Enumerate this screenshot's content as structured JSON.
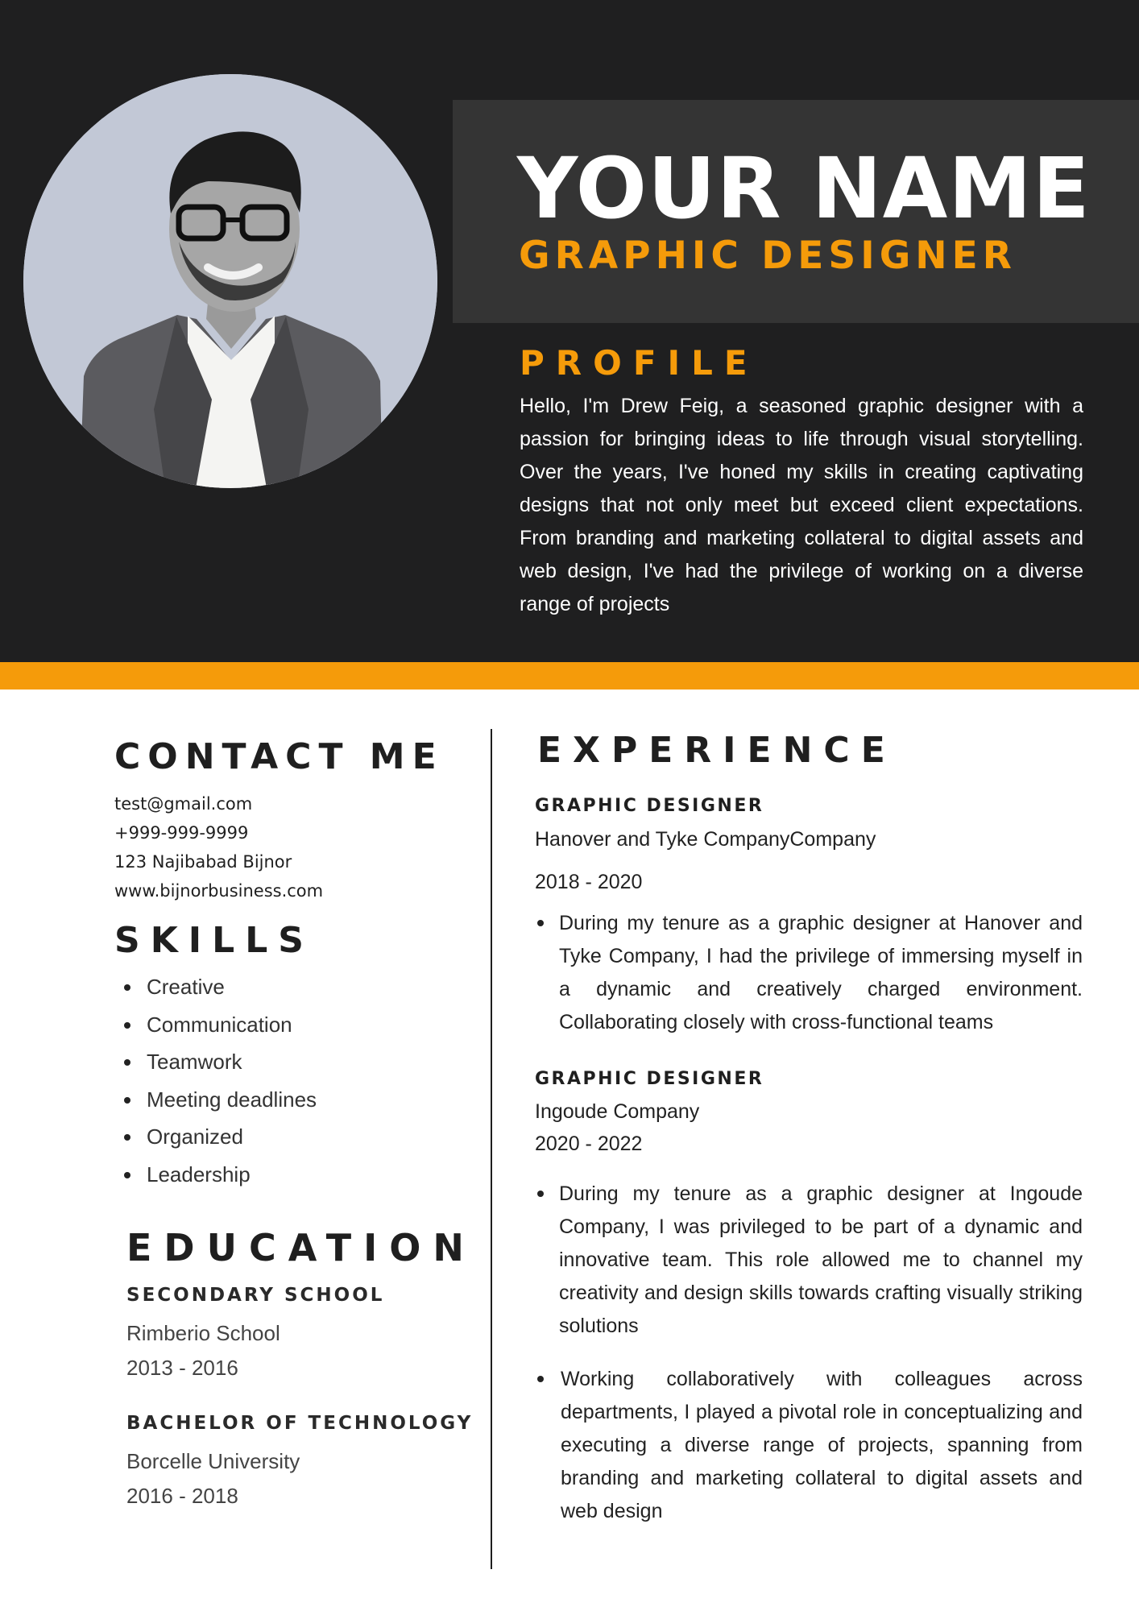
{
  "header": {
    "name": "YOUR NAME",
    "title": "GRAPHIC DESIGNER",
    "photo_icon": "profile-photo",
    "colors": {
      "background": "#1f1f20",
      "panel": "#343434",
      "accent": "#f59b0a"
    }
  },
  "profile": {
    "heading": "PROFILE",
    "text": "Hello, I'm Drew Feig, a seasoned graphic designer with a passion for bringing ideas to life through visual storytelling. Over the years, I've honed my skills in creating captivating designs that not only meet but exceed client expectations. From branding and marketing collateral to digital assets and web design, I've had the privilege of working on a diverse range of projects"
  },
  "contact": {
    "heading": "CONTACT ME",
    "email": "test@gmail.com",
    "phone": "+999-999-9999",
    "address": "123 Najibabad Bijnor",
    "website": "www.bijnorbusiness.com"
  },
  "skills": {
    "heading": "SKILLS",
    "items": [
      "Creative",
      "Communication",
      "Teamwork",
      "Meeting deadlines",
      "Organized",
      "Leadership"
    ]
  },
  "education": {
    "heading": "EDUCATION",
    "entries": [
      {
        "title": "SECONDARY SCHOOL",
        "school": "Rimberio School",
        "years": "2013 - 2016"
      },
      {
        "title": "BACHELOR OF TECHNOLOGY",
        "school": "Borcelle University",
        "years": "2016 - 2018"
      }
    ]
  },
  "experience": {
    "heading": "EXPERIENCE",
    "entries": [
      {
        "title": "GRAPHIC DESIGNER",
        "company": "Hanover and Tyke CompanyCompany",
        "years": "2018 - 2020",
        "bullets": [
          "During my tenure as a graphic designer at Hanover and Tyke Company, I had the privilege of immersing myself in a dynamic and creatively charged environment. Collaborating closely with cross-functional teams"
        ]
      },
      {
        "title": "GRAPHIC DESIGNER",
        "company": "Ingoude Company",
        "years": "2020 - 2022",
        "bullets": [
          "During my tenure as a graphic designer at Ingoude Company, I was privileged to be part of a dynamic and innovative team. This role allowed me to channel my creativity and design skills towards crafting visually striking solutions",
          "Working collaboratively with colleagues across departments, I played a pivotal role in conceptualizing and executing a diverse range of projects, spanning from branding and marketing collateral to digital assets and web design"
        ]
      }
    ]
  }
}
